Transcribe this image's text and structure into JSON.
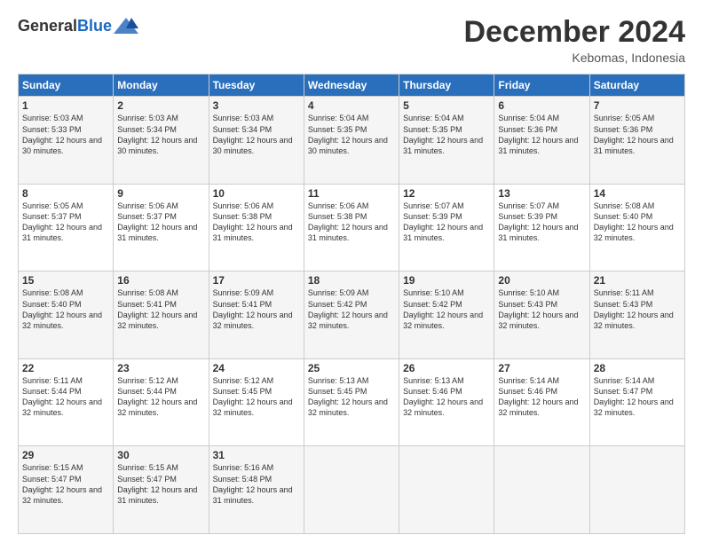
{
  "logo": {
    "general": "General",
    "blue": "Blue"
  },
  "title": "December 2024",
  "location": "Kebomas, Indonesia",
  "days_header": [
    "Sunday",
    "Monday",
    "Tuesday",
    "Wednesday",
    "Thursday",
    "Friday",
    "Saturday"
  ],
  "weeks": [
    [
      {
        "day": "1",
        "sunrise": "Sunrise: 5:03 AM",
        "sunset": "Sunset: 5:33 PM",
        "daylight": "Daylight: 12 hours and 30 minutes."
      },
      {
        "day": "2",
        "sunrise": "Sunrise: 5:03 AM",
        "sunset": "Sunset: 5:34 PM",
        "daylight": "Daylight: 12 hours and 30 minutes."
      },
      {
        "day": "3",
        "sunrise": "Sunrise: 5:03 AM",
        "sunset": "Sunset: 5:34 PM",
        "daylight": "Daylight: 12 hours and 30 minutes."
      },
      {
        "day": "4",
        "sunrise": "Sunrise: 5:04 AM",
        "sunset": "Sunset: 5:35 PM",
        "daylight": "Daylight: 12 hours and 30 minutes."
      },
      {
        "day": "5",
        "sunrise": "Sunrise: 5:04 AM",
        "sunset": "Sunset: 5:35 PM",
        "daylight": "Daylight: 12 hours and 31 minutes."
      },
      {
        "day": "6",
        "sunrise": "Sunrise: 5:04 AM",
        "sunset": "Sunset: 5:36 PM",
        "daylight": "Daylight: 12 hours and 31 minutes."
      },
      {
        "day": "7",
        "sunrise": "Sunrise: 5:05 AM",
        "sunset": "Sunset: 5:36 PM",
        "daylight": "Daylight: 12 hours and 31 minutes."
      }
    ],
    [
      {
        "day": "8",
        "sunrise": "Sunrise: 5:05 AM",
        "sunset": "Sunset: 5:37 PM",
        "daylight": "Daylight: 12 hours and 31 minutes."
      },
      {
        "day": "9",
        "sunrise": "Sunrise: 5:06 AM",
        "sunset": "Sunset: 5:37 PM",
        "daylight": "Daylight: 12 hours and 31 minutes."
      },
      {
        "day": "10",
        "sunrise": "Sunrise: 5:06 AM",
        "sunset": "Sunset: 5:38 PM",
        "daylight": "Daylight: 12 hours and 31 minutes."
      },
      {
        "day": "11",
        "sunrise": "Sunrise: 5:06 AM",
        "sunset": "Sunset: 5:38 PM",
        "daylight": "Daylight: 12 hours and 31 minutes."
      },
      {
        "day": "12",
        "sunrise": "Sunrise: 5:07 AM",
        "sunset": "Sunset: 5:39 PM",
        "daylight": "Daylight: 12 hours and 31 minutes."
      },
      {
        "day": "13",
        "sunrise": "Sunrise: 5:07 AM",
        "sunset": "Sunset: 5:39 PM",
        "daylight": "Daylight: 12 hours and 31 minutes."
      },
      {
        "day": "14",
        "sunrise": "Sunrise: 5:08 AM",
        "sunset": "Sunset: 5:40 PM",
        "daylight": "Daylight: 12 hours and 32 minutes."
      }
    ],
    [
      {
        "day": "15",
        "sunrise": "Sunrise: 5:08 AM",
        "sunset": "Sunset: 5:40 PM",
        "daylight": "Daylight: 12 hours and 32 minutes."
      },
      {
        "day": "16",
        "sunrise": "Sunrise: 5:08 AM",
        "sunset": "Sunset: 5:41 PM",
        "daylight": "Daylight: 12 hours and 32 minutes."
      },
      {
        "day": "17",
        "sunrise": "Sunrise: 5:09 AM",
        "sunset": "Sunset: 5:41 PM",
        "daylight": "Daylight: 12 hours and 32 minutes."
      },
      {
        "day": "18",
        "sunrise": "Sunrise: 5:09 AM",
        "sunset": "Sunset: 5:42 PM",
        "daylight": "Daylight: 12 hours and 32 minutes."
      },
      {
        "day": "19",
        "sunrise": "Sunrise: 5:10 AM",
        "sunset": "Sunset: 5:42 PM",
        "daylight": "Daylight: 12 hours and 32 minutes."
      },
      {
        "day": "20",
        "sunrise": "Sunrise: 5:10 AM",
        "sunset": "Sunset: 5:43 PM",
        "daylight": "Daylight: 12 hours and 32 minutes."
      },
      {
        "day": "21",
        "sunrise": "Sunrise: 5:11 AM",
        "sunset": "Sunset: 5:43 PM",
        "daylight": "Daylight: 12 hours and 32 minutes."
      }
    ],
    [
      {
        "day": "22",
        "sunrise": "Sunrise: 5:11 AM",
        "sunset": "Sunset: 5:44 PM",
        "daylight": "Daylight: 12 hours and 32 minutes."
      },
      {
        "day": "23",
        "sunrise": "Sunrise: 5:12 AM",
        "sunset": "Sunset: 5:44 PM",
        "daylight": "Daylight: 12 hours and 32 minutes."
      },
      {
        "day": "24",
        "sunrise": "Sunrise: 5:12 AM",
        "sunset": "Sunset: 5:45 PM",
        "daylight": "Daylight: 12 hours and 32 minutes."
      },
      {
        "day": "25",
        "sunrise": "Sunrise: 5:13 AM",
        "sunset": "Sunset: 5:45 PM",
        "daylight": "Daylight: 12 hours and 32 minutes."
      },
      {
        "day": "26",
        "sunrise": "Sunrise: 5:13 AM",
        "sunset": "Sunset: 5:46 PM",
        "daylight": "Daylight: 12 hours and 32 minutes."
      },
      {
        "day": "27",
        "sunrise": "Sunrise: 5:14 AM",
        "sunset": "Sunset: 5:46 PM",
        "daylight": "Daylight: 12 hours and 32 minutes."
      },
      {
        "day": "28",
        "sunrise": "Sunrise: 5:14 AM",
        "sunset": "Sunset: 5:47 PM",
        "daylight": "Daylight: 12 hours and 32 minutes."
      }
    ],
    [
      {
        "day": "29",
        "sunrise": "Sunrise: 5:15 AM",
        "sunset": "Sunset: 5:47 PM",
        "daylight": "Daylight: 12 hours and 32 minutes."
      },
      {
        "day": "30",
        "sunrise": "Sunrise: 5:15 AM",
        "sunset": "Sunset: 5:47 PM",
        "daylight": "Daylight: 12 hours and 31 minutes."
      },
      {
        "day": "31",
        "sunrise": "Sunrise: 5:16 AM",
        "sunset": "Sunset: 5:48 PM",
        "daylight": "Daylight: 12 hours and 31 minutes."
      },
      null,
      null,
      null,
      null
    ]
  ]
}
